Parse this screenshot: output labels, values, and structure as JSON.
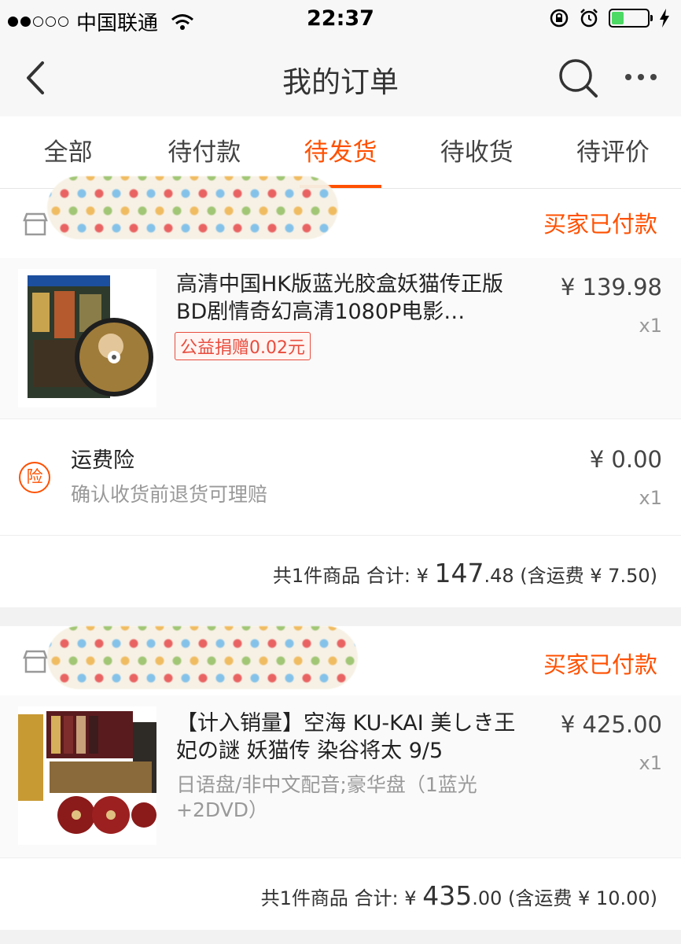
{
  "status_bar": {
    "carrier": "中国联通",
    "time": "22:37",
    "battery_level": 0.35,
    "signal_bars": 2
  },
  "nav": {
    "title": "我的订单",
    "back_icon": "chevron-left-icon",
    "search_icon": "search-icon",
    "more_icon": "more-icon"
  },
  "tabs": [
    {
      "label": "全部",
      "active": false
    },
    {
      "label": "待付款",
      "active": false
    },
    {
      "label": "待发货",
      "active": true
    },
    {
      "label": "待收货",
      "active": false
    },
    {
      "label": "待评价",
      "active": false
    }
  ],
  "orders": [
    {
      "status": "买家已付款",
      "item": {
        "title": "高清中国HK版蓝光胶盒妖猫传正版BD剧情奇幻高清1080P电影…",
        "price": "¥ 139.98",
        "qty": "x1",
        "charity": "公益捐赠0.02元"
      },
      "insurance": {
        "title": "运费险",
        "subtitle": "确认收货前退货可理赔",
        "icon_text": "险",
        "price": "¥ 0.00",
        "qty": "x1"
      },
      "total": {
        "count": "共1件商品",
        "label": "合计:",
        "currency": "¥",
        "amount_int": "147",
        "amount_dec": ".48",
        "shipping": "(含运费 ¥ 7.50)"
      }
    },
    {
      "status": "买家已付款",
      "item": {
        "title": "【计入销量】空海 KU-KAI 美しき王妃の謎 妖猫传 染谷将太 9/5",
        "price": "¥ 425.00",
        "qty": "x1",
        "sku": "日语盘/非中文配音;豪华盘（1蓝光+2DVD）"
      },
      "total": {
        "count": "共1件商品",
        "label": "合计:",
        "currency": "¥",
        "amount_int": "435",
        "amount_dec": ".00",
        "shipping": "(含运费 ¥ 10.00)"
      }
    }
  ],
  "colors": {
    "accent": "#ff5000",
    "charity": "#e84c3d"
  }
}
